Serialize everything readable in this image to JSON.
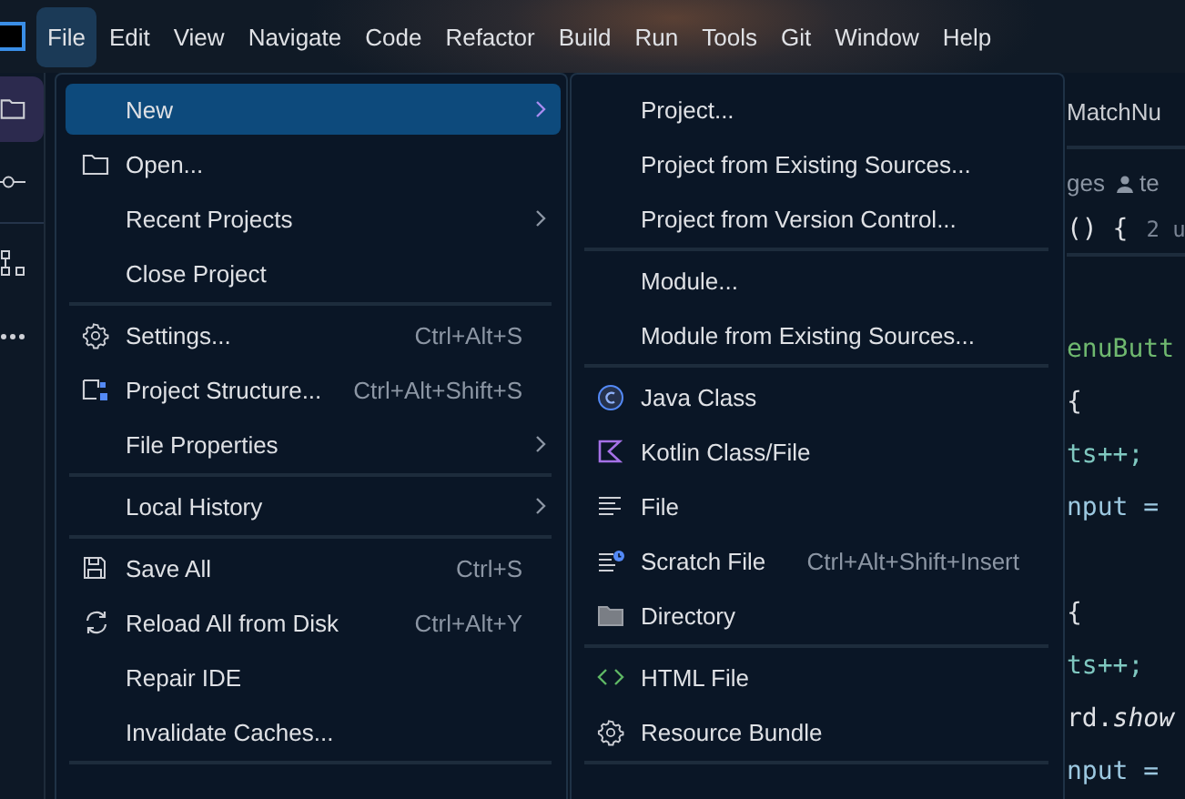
{
  "menubar": [
    {
      "label": "File",
      "selected": true
    },
    {
      "label": "Edit",
      "selected": false
    },
    {
      "label": "View",
      "selected": false
    },
    {
      "label": "Navigate",
      "selected": false
    },
    {
      "label": "Code",
      "selected": false
    },
    {
      "label": "Refactor",
      "selected": false
    },
    {
      "label": "Build",
      "selected": false
    },
    {
      "label": "Run",
      "selected": false
    },
    {
      "label": "Tools",
      "selected": false
    },
    {
      "label": "Git",
      "selected": false
    },
    {
      "label": "Window",
      "selected": false
    },
    {
      "label": "Help",
      "selected": false
    }
  ],
  "toolstrip": [
    {
      "selected": true
    },
    {
      "selected": false
    },
    {
      "selected": false
    },
    {
      "selected": false
    }
  ],
  "file_menu": {
    "groups": [
      [
        {
          "label": "New",
          "selected": true,
          "submenu": true
        },
        {
          "label": "Open...",
          "selected": false,
          "submenu": false
        },
        {
          "label": "Recent Projects",
          "selected": false,
          "submenu": true
        },
        {
          "label": "Close Project",
          "selected": false,
          "submenu": false
        }
      ],
      [
        {
          "label": "Settings...",
          "shortcut": "Ctrl+Alt+S",
          "selected": false,
          "submenu": false
        },
        {
          "label": "Project Structure...",
          "shortcut": "Ctrl+Alt+Shift+S",
          "selected": false,
          "submenu": false
        },
        {
          "label": "File Properties",
          "selected": false,
          "submenu": true
        }
      ],
      [
        {
          "label": "Local History",
          "selected": false,
          "submenu": true
        }
      ],
      [
        {
          "label": "Save All",
          "shortcut": "Ctrl+S",
          "selected": false,
          "submenu": false
        },
        {
          "label": "Reload All from Disk",
          "shortcut": "Ctrl+Alt+Y",
          "selected": false,
          "submenu": false
        },
        {
          "label": "Repair IDE",
          "selected": false,
          "submenu": false
        },
        {
          "label": "Invalidate Caches...",
          "selected": false,
          "submenu": false
        }
      ]
    ]
  },
  "new_submenu": {
    "groups": [
      [
        {
          "label": "Project...",
          "selected": false,
          "submenu": false
        },
        {
          "label": "Project from Existing Sources...",
          "selected": false,
          "submenu": false
        },
        {
          "label": "Project from Version Control...",
          "selected": false,
          "submenu": false
        }
      ],
      [
        {
          "label": "Module...",
          "selected": false,
          "submenu": false
        },
        {
          "label": "Module from Existing Sources...",
          "selected": false,
          "submenu": false
        }
      ],
      [
        {
          "label": "Java Class",
          "selected": false,
          "submenu": false
        },
        {
          "label": "Kotlin Class/File",
          "selected": false,
          "submenu": false
        },
        {
          "label": "File",
          "selected": false,
          "submenu": false
        },
        {
          "label": "Scratch File",
          "shortcut": "Ctrl+Alt+Shift+Insert",
          "selected": false,
          "submenu": false
        },
        {
          "label": "Directory",
          "selected": false,
          "submenu": false
        }
      ],
      [
        {
          "label": "HTML File",
          "selected": false,
          "submenu": false
        },
        {
          "label": "Resource Bundle",
          "selected": false,
          "submenu": false
        }
      ]
    ]
  },
  "editor": {
    "tab": "MatchNu",
    "usages": "ges",
    "author": "te",
    "signature": "() {",
    "hint": "2 u",
    "lines": [
      {
        "kind": "blank"
      },
      {
        "kind": "method",
        "text": "enuButt"
      },
      {
        "kind": "plain",
        "text": "{"
      },
      {
        "kind": "field",
        "text": "ts++;"
      },
      {
        "kind": "assign",
        "text": "nput ="
      },
      {
        "kind": "blank"
      },
      {
        "kind": "plain",
        "text": "{"
      },
      {
        "kind": "field",
        "text": "ts++;"
      },
      {
        "kind": "call",
        "text": "rd.*show*"
      },
      {
        "kind": "assign",
        "text": "nput ="
      }
    ]
  }
}
